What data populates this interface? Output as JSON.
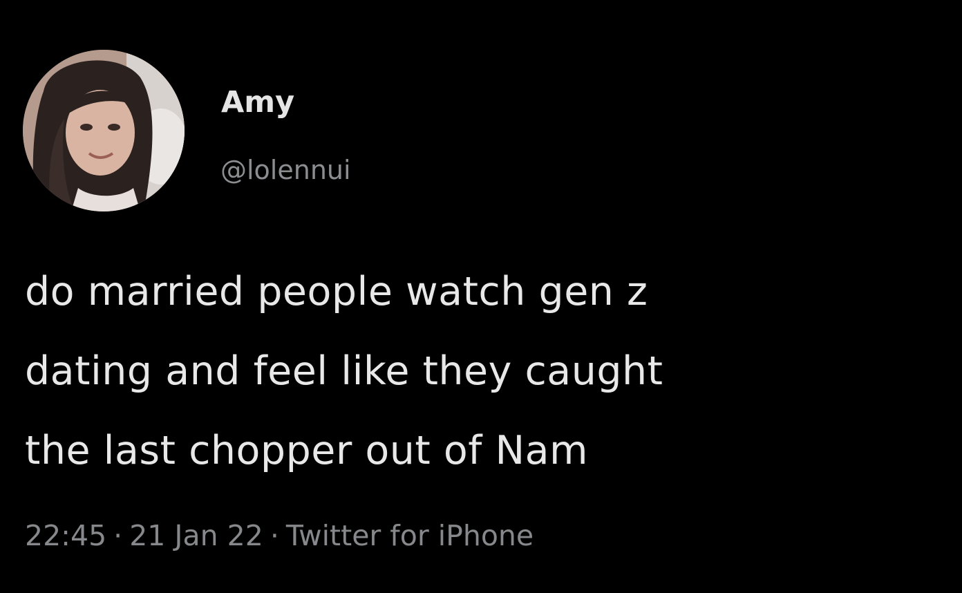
{
  "tweet": {
    "author": {
      "display_name": "Amy",
      "handle": "@lolennui",
      "avatar_icon": "profile-photo"
    },
    "text_lines": [
      "do married people watch gen z",
      "dating and feel like they caught",
      "the last chopper out of Nam"
    ],
    "meta": {
      "time": "22:45",
      "separator": "·",
      "date": "21 Jan 22",
      "source": "Twitter for iPhone"
    }
  },
  "colors": {
    "background": "#000000",
    "primary_text": "#e8e8e8",
    "secondary_text": "#8b8d90"
  }
}
